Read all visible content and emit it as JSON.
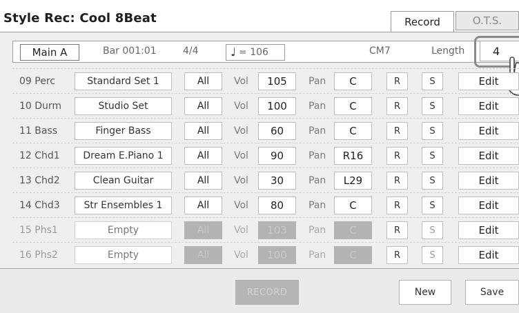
{
  "header": {
    "title": "Style Rec: Cool 8Beat",
    "tabs": [
      {
        "label": "Record",
        "active": true
      },
      {
        "label": "O.T.S.",
        "active": false
      }
    ]
  },
  "info": {
    "pattern": "Main A",
    "bar_position": "Bar 001:01",
    "time_signature": "4/4",
    "tempo_symbol": "♩",
    "tempo": "= 106",
    "chord": "CM7",
    "length_label": "Length",
    "length_value": "4"
  },
  "tracks": [
    {
      "name": "09 Perc",
      "voice": "Standard Set 1",
      "all": "All",
      "vol_label": "Vol",
      "vol": "105",
      "pan_label": "Pan",
      "pan": "C",
      "r": "R",
      "s": "S",
      "edit": "Edit",
      "active": true
    },
    {
      "name": "10 Durm",
      "voice": "Studio Set",
      "all": "All",
      "vol_label": "Vol",
      "vol": "100",
      "pan_label": "Pan",
      "pan": "C",
      "r": "R",
      "s": "S",
      "edit": "Edit",
      "active": true
    },
    {
      "name": "11 Bass",
      "voice": "Finger Bass",
      "all": "All",
      "vol_label": "Vol",
      "vol": "60",
      "pan_label": "Pan",
      "pan": "C",
      "r": "R",
      "s": "S",
      "edit": "Edit",
      "active": true
    },
    {
      "name": "12 Chd1",
      "voice": "Dream E.Piano 1",
      "all": "All",
      "vol_label": "Vol",
      "vol": "90",
      "pan_label": "Pan",
      "pan": "R16",
      "r": "R",
      "s": "S",
      "edit": "Edit",
      "active": true
    },
    {
      "name": "13 Chd2",
      "voice": "Clean Guitar",
      "all": "All",
      "vol_label": "Vol",
      "vol": "30",
      "pan_label": "Pan",
      "pan": "L29",
      "r": "R",
      "s": "S",
      "edit": "Edit",
      "active": true
    },
    {
      "name": "14 Chd3",
      "voice": "Str Ensembles 1",
      "all": "All",
      "vol_label": "Vol",
      "vol": "80",
      "pan_label": "Pan",
      "pan": "C",
      "r": "R",
      "s": "S",
      "edit": "Edit",
      "active": true
    },
    {
      "name": "15 Phs1",
      "voice": "Empty",
      "all": "All",
      "vol_label": "Vol",
      "vol": "103",
      "pan_label": "Pan",
      "pan": "C",
      "r": "R",
      "s": "S",
      "edit": "Edit",
      "active": false
    },
    {
      "name": "16 Phs2",
      "voice": "Empty",
      "all": "All",
      "vol_label": "Vol",
      "vol": "100",
      "pan_label": "Pan",
      "pan": "C",
      "r": "R",
      "s": "S",
      "edit": "Edit",
      "active": false
    }
  ],
  "footer": {
    "record": "RECORD",
    "new": "New",
    "save": "Save"
  },
  "icons": {
    "pointer": "hand-pointer-icon"
  }
}
